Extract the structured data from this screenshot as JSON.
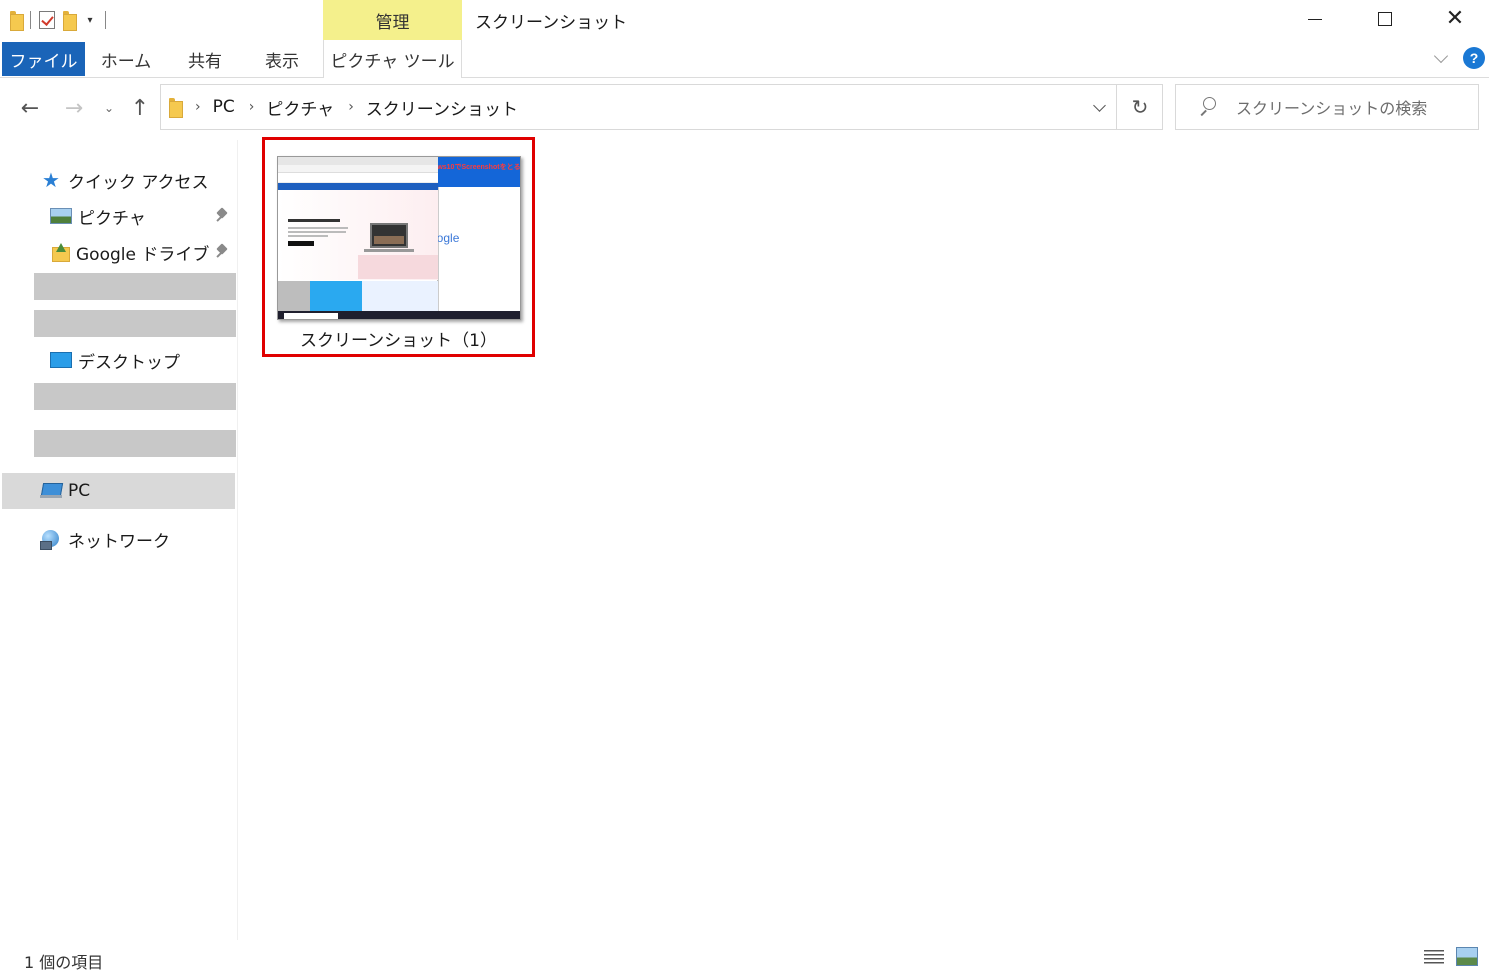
{
  "titlebar": {
    "manage_tab": "管理",
    "window_title": "スクリーンショット",
    "qat_dropdown": "▾",
    "minimize": "",
    "maximize": "",
    "close": "✕"
  },
  "ribbon": {
    "tabs": {
      "file": "ファイル",
      "home": "ホーム",
      "share": "共有",
      "view": "表示",
      "picture_tools": "ピクチャ ツール"
    },
    "help": "?"
  },
  "navigation": {
    "back": "←",
    "forward": "→",
    "recent": "⌄",
    "up": "↑",
    "breadcrumbs": [
      "PC",
      "ピクチャ",
      "スクリーンショット"
    ],
    "separator": "›",
    "refresh": "↻"
  },
  "search": {
    "placeholder": "スクリーンショットの検索"
  },
  "sidebar": {
    "quick_access": "クイック アクセス",
    "pictures": "ピクチャ",
    "google_drive": "Google ドライブ",
    "desktop": "デスクトップ",
    "pc": "PC",
    "network": "ネットワーク"
  },
  "content": {
    "files": [
      {
        "name": "スクリーンショット（1）",
        "thumbnail_caption": "Windows10でScreenshotをとる方法"
      }
    ],
    "thumbnail_google": "oogle"
  },
  "status": {
    "item_count": "1 個の項目"
  },
  "colors": {
    "file_tab": "#1a64b8",
    "manage_tab": "#f4f08c",
    "selection_border": "#e00000",
    "sidebar_selected": "#d9d9d9",
    "redacted": "#c8c8c8"
  }
}
